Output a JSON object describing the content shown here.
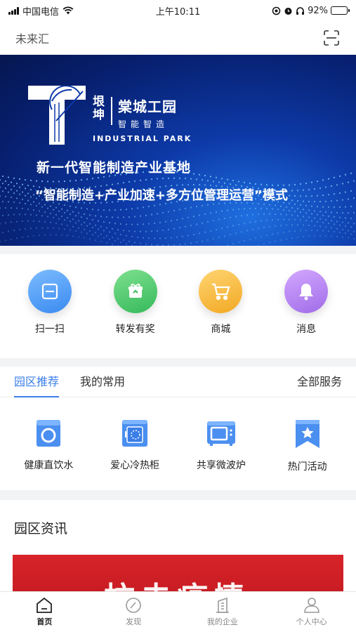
{
  "status_bar": {
    "carrier": "中国电信",
    "time": "上午10:11",
    "battery": "92%",
    "battery_level": 0.92
  },
  "header": {
    "title": "未来汇",
    "scan_icon": "scan-icon"
  },
  "banner": {
    "logo_small": "垠坤",
    "logo_main": "棠城工园",
    "logo_sub": "智能智造",
    "logo_en": "INDUSTRIAL PARK",
    "line1": "新一代智能制造产业基地",
    "line2": "“智能制造+产业加速+多方位管理运营”模式",
    "colors": {
      "primary": "#0d3aa8",
      "dark": "#061650",
      "glow": "#1f6fe0"
    }
  },
  "quick_actions": [
    {
      "label": "扫一扫",
      "icon": "scan-icon",
      "color": "#4b9cf5"
    },
    {
      "label": "转发有奖",
      "icon": "gift-icon",
      "color": "#4cc971"
    },
    {
      "label": "商城",
      "icon": "cart-icon",
      "color": "#f5b93a"
    },
    {
      "label": "消息",
      "icon": "bell-icon",
      "color": "#b57ff0"
    }
  ],
  "services": {
    "tabs": [
      {
        "label": "园区推荐",
        "active": true
      },
      {
        "label": "我的常用",
        "active": false
      }
    ],
    "all_label": "全部服务",
    "items": [
      {
        "label": "健康直饮水",
        "icon": "water-dispenser-icon"
      },
      {
        "label": "爱心冷热柜",
        "icon": "locker-icon"
      },
      {
        "label": "共享微波炉",
        "icon": "microwave-icon"
      },
      {
        "label": "热门活动",
        "icon": "star-bookmark-icon"
      }
    ],
    "accent": "#3a7ee8"
  },
  "news": {
    "title": "园区资讯",
    "image_text": "抗击疫情"
  },
  "bottom_nav": [
    {
      "label": "首页",
      "icon": "home-icon",
      "active": true
    },
    {
      "label": "发现",
      "icon": "compass-icon",
      "active": false
    },
    {
      "label": "我的企业",
      "icon": "building-icon",
      "active": false
    },
    {
      "label": "个人中心",
      "icon": "user-icon",
      "active": false
    }
  ]
}
